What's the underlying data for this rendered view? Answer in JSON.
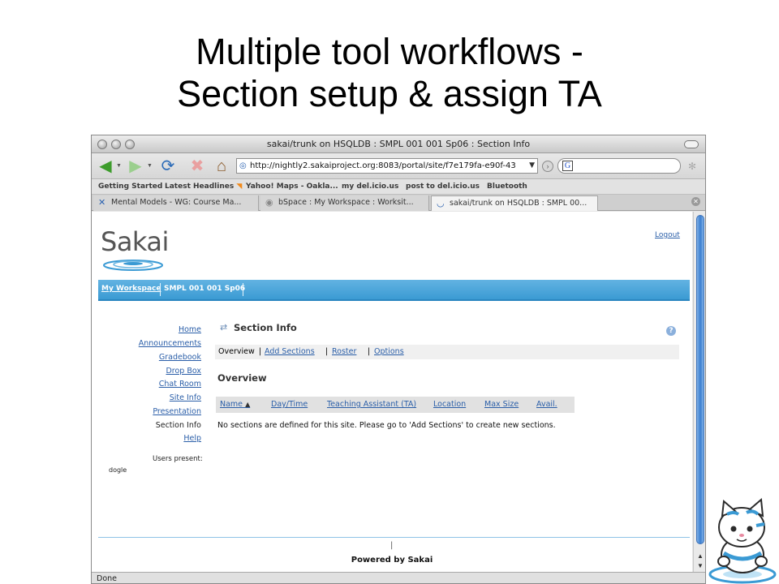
{
  "slide": {
    "title_line1": "Multiple tool workflows -",
    "title_line2": "Section setup & assign TA"
  },
  "browser": {
    "window_title": "sakai/trunk on HSQLDB : SMPL 001 001 Sp06 : Section Info",
    "url": "http://nightly2.sakaiproject.org:8083/portal/site/f7e179fa-e90f-43",
    "search_value": "",
    "bookmarks": [
      "Getting Started",
      "Latest Headlines",
      "Yahoo! Maps - Oakla...",
      "my del.icio.us",
      "post to del.icio.us",
      "Bluetooth"
    ],
    "tabs": [
      {
        "label": "Mental Models - WG: Course Ma...",
        "active": false
      },
      {
        "label": "bSpace : My Workspace : Worksit...",
        "active": false
      },
      {
        "label": "sakai/trunk on HSQLDB : SMPL 00...",
        "active": true
      }
    ],
    "status": "Done"
  },
  "page": {
    "logo_text": "Sakai",
    "logout": "Logout",
    "site_tabs": [
      "My Workspace",
      "SMPL 001 001 Sp06"
    ],
    "left_nav": [
      "Home",
      "Announcements",
      "Gradebook",
      "Drop Box",
      "Chat Room",
      "Site Info",
      "Presentation",
      "Section Info",
      "Help"
    ],
    "current_nav": "Section Info",
    "users_present_label": "Users present:",
    "users": [
      "dogle"
    ],
    "tool_title": "Section Info",
    "subnav": {
      "overview": "Overview",
      "add_sections": "Add Sections",
      "roster": "Roster",
      "options": "Options"
    },
    "overview_heading": "Overview",
    "table_columns": [
      "Name",
      "Day/Time",
      "Teaching Assistant (TA)",
      "Location",
      "Max Size",
      "Avail."
    ],
    "empty_message": "No sections are defined for this site. Please go to 'Add Sections' to create new sections.",
    "footer_separator": "|",
    "powered_by": "Powered by Sakai"
  },
  "colors": {
    "site_bar": "#3b9bd3",
    "link": "#2a5ea8"
  }
}
